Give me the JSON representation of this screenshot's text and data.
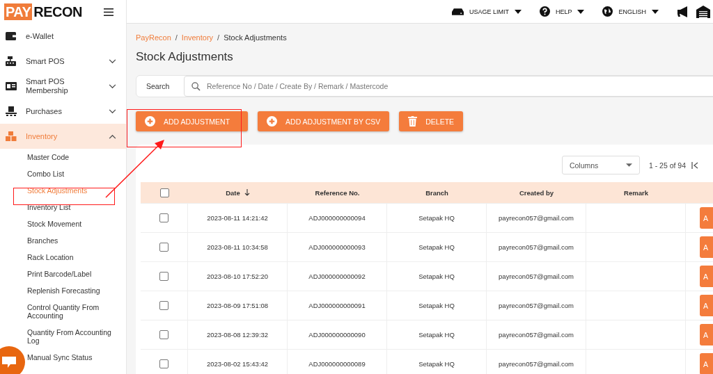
{
  "logo": {
    "part_1": "PAY",
    "part_2": "RECON"
  },
  "topbar": {
    "items": [
      {
        "label": "USAGE LIMIT"
      },
      {
        "label": "HELP"
      },
      {
        "label": "ENGLISH"
      }
    ]
  },
  "sidebar": {
    "items": [
      {
        "label": "e-Wallet",
        "kind": "link",
        "selected": false
      },
      {
        "label": "Smart POS",
        "kind": "group",
        "expanded": false,
        "selected": false
      },
      {
        "label": "Smart POS Membership",
        "kind": "group",
        "expanded": false,
        "selected": false
      },
      {
        "label": "Purchases",
        "kind": "group",
        "expanded": false,
        "selected": false
      },
      {
        "label": "Inventory",
        "kind": "group",
        "expanded": true,
        "selected": true,
        "children": [
          {
            "label": "Master Code",
            "selected": false
          },
          {
            "label": "Combo List",
            "selected": false
          },
          {
            "label": "Stock Adjustments",
            "selected": true
          },
          {
            "label": "Inventory List",
            "selected": false
          },
          {
            "label": "Stock Movement",
            "selected": false
          },
          {
            "label": "Branches",
            "selected": false
          },
          {
            "label": "Rack Location",
            "selected": false
          },
          {
            "label": "Print Barcode/Label",
            "selected": false
          },
          {
            "label": "Replenish Forecasting",
            "selected": false
          },
          {
            "label": "Control Quantity From Accounting",
            "selected": false
          },
          {
            "label": "Quantity From Accounting Log",
            "selected": false
          },
          {
            "label": "Manual Sync Status",
            "selected": false
          }
        ]
      }
    ]
  },
  "breadcrumb": {
    "separator": "/",
    "items": [
      "PayRecon",
      "Inventory",
      "Stock Adjustments"
    ]
  },
  "page_title": "Stock Adjustments",
  "search": {
    "label": "Search",
    "placeholder": "Reference No / Date / Create By / Remark / Mastercode"
  },
  "actions": [
    {
      "label": "ADD ADJUSTMENT",
      "kind": "add"
    },
    {
      "label": "ADD ADJUSTMENT BY CSV",
      "kind": "add"
    },
    {
      "label": "DELETE",
      "kind": "delete"
    }
  ],
  "columns_select": {
    "placeholder": "Columns"
  },
  "pagination": {
    "range": "1 - 25 of 94"
  },
  "table": {
    "select_all": {
      "checked": false
    },
    "columns": [
      "Date",
      "Reference No.",
      "Branch",
      "Created by",
      "Remark"
    ],
    "rows": [
      {
        "checked": false,
        "date": "2023-08-11 14:21:42",
        "reference": "ADJ000000000094",
        "branch": "Setapak HQ",
        "created_by": "payrecon057@gmail.com",
        "action": "A"
      },
      {
        "checked": false,
        "date": "2023-08-11 10:34:58",
        "reference": "ADJ000000000093",
        "branch": "Setapak HQ",
        "created_by": "payrecon057@gmail.com",
        "action": "A"
      },
      {
        "checked": false,
        "date": "2023-08-10 17:52:20",
        "reference": "ADJ000000000092",
        "branch": "Setapak HQ",
        "created_by": "payrecon057@gmail.com",
        "action": "A"
      },
      {
        "checked": false,
        "date": "2023-08-09 17:51:08",
        "reference": "ADJ000000000091",
        "branch": "Setapak HQ",
        "created_by": "payrecon057@gmail.com",
        "action": "A"
      },
      {
        "checked": false,
        "date": "2023-08-08 12:39:32",
        "reference": "ADJ000000000090",
        "branch": "Setapak HQ",
        "created_by": "payrecon057@gmail.com",
        "action": "A"
      },
      {
        "checked": false,
        "date": "2023-08-02 15:43:42",
        "reference": "ADJ000000000089",
        "branch": "Setapak HQ",
        "created_by": "payrecon057@gmail.com",
        "action": "A"
      }
    ]
  }
}
